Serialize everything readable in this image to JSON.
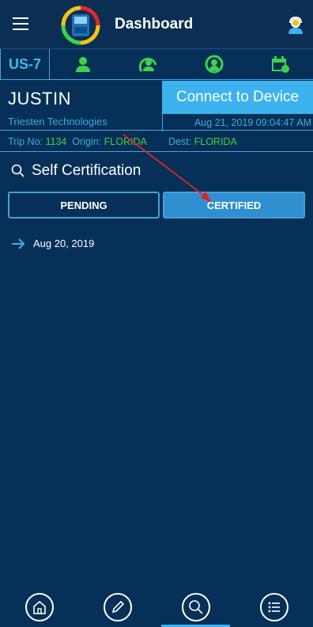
{
  "app": {
    "title": "Dashboard"
  },
  "status": {
    "cycle": "US-7"
  },
  "driver": {
    "name": "JUSTIN",
    "company": "Triesten Technologies",
    "connect_label": "Connect to Device",
    "datetime": "Aug 21, 2019 09:04:47 AM"
  },
  "trip": {
    "no_label": "Trip No:",
    "no": "1134",
    "origin_label": "Origin:",
    "origin": "FLORIDA",
    "dest_label": "Dest:",
    "dest": "FLORIDA"
  },
  "section": {
    "title": "Self Certification"
  },
  "tabs": {
    "pending": "PENDING",
    "certified": "CERTIFIED"
  },
  "entries": [
    {
      "date": "Aug 20, 2019"
    }
  ],
  "colors": {
    "accent": "#3cb2ee",
    "green": "#3ed24b",
    "background": "#063057"
  },
  "icons": [
    "menu-icon",
    "app-logo",
    "support-icon",
    "driver-status-icon",
    "on-duty-icon",
    "sync-icon",
    "calendar-icon",
    "search-icon",
    "arrow-right-icon",
    "home-icon",
    "edit-icon",
    "search-icon",
    "list-icon"
  ]
}
